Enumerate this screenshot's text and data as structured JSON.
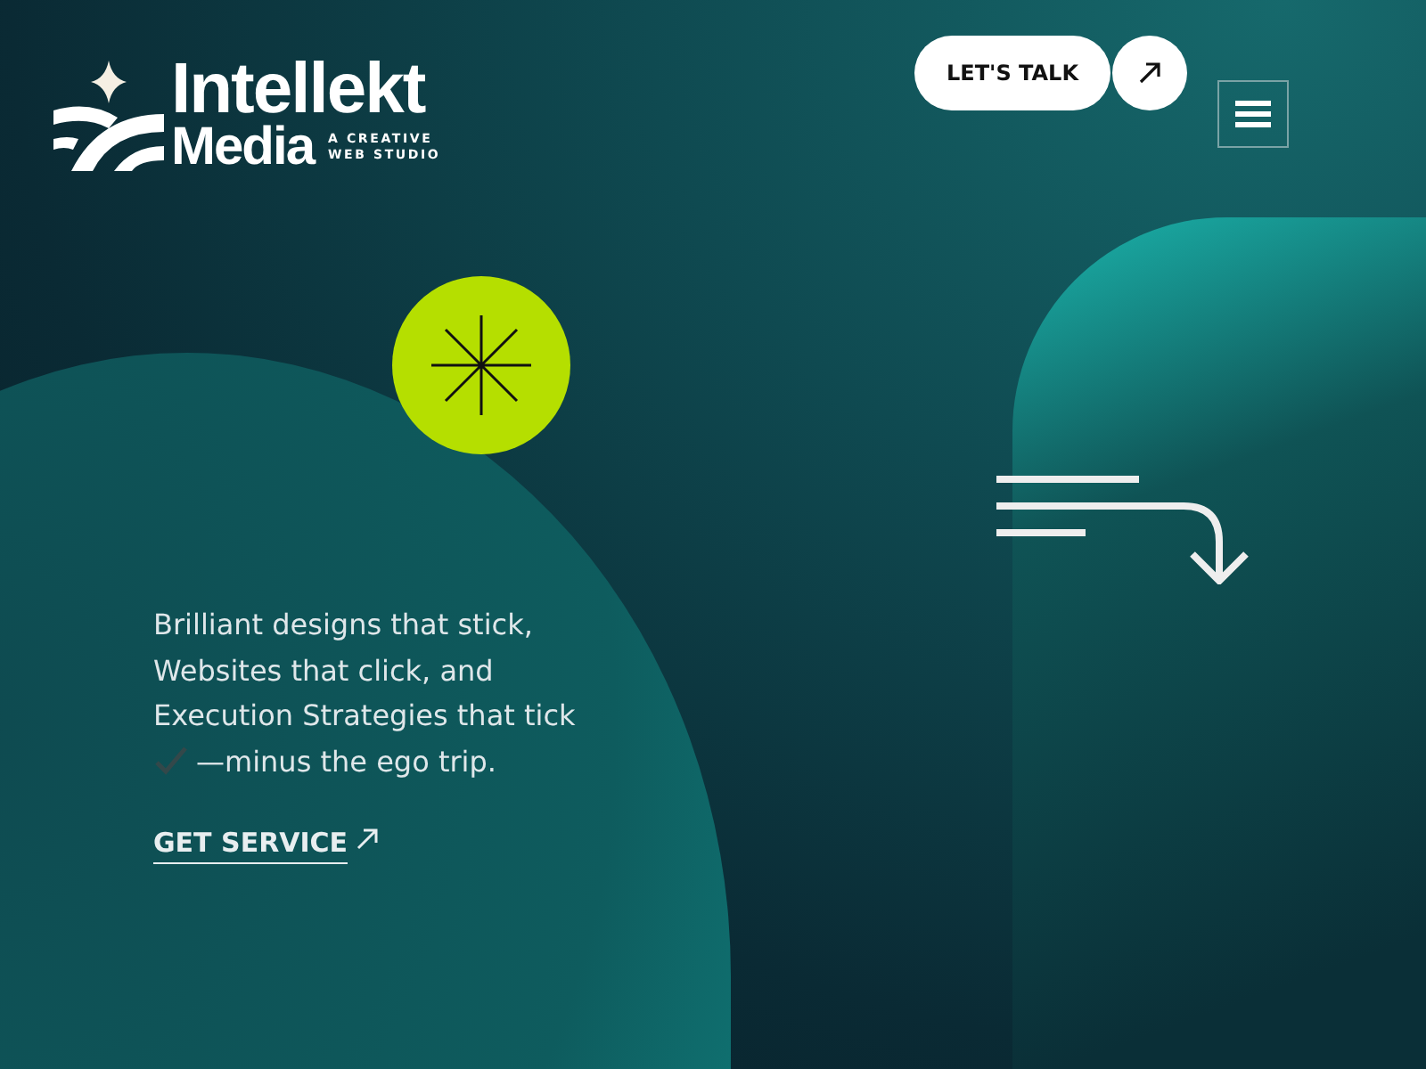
{
  "logo": {
    "name_line_1": "Intellekt",
    "name_line_2": "Media",
    "tagline_line_1": "A CREATIVE",
    "tagline_line_2": "WEB STUDIO"
  },
  "header": {
    "cta_label": "LET'S TALK"
  },
  "hero": {
    "lines": [
      "Brilliant designs that stick,",
      "Websites that click, and",
      "Execution Strategies that tick"
    ],
    "last_line": "—minus the ego trip.",
    "link_label": "GET SERVICE"
  }
}
